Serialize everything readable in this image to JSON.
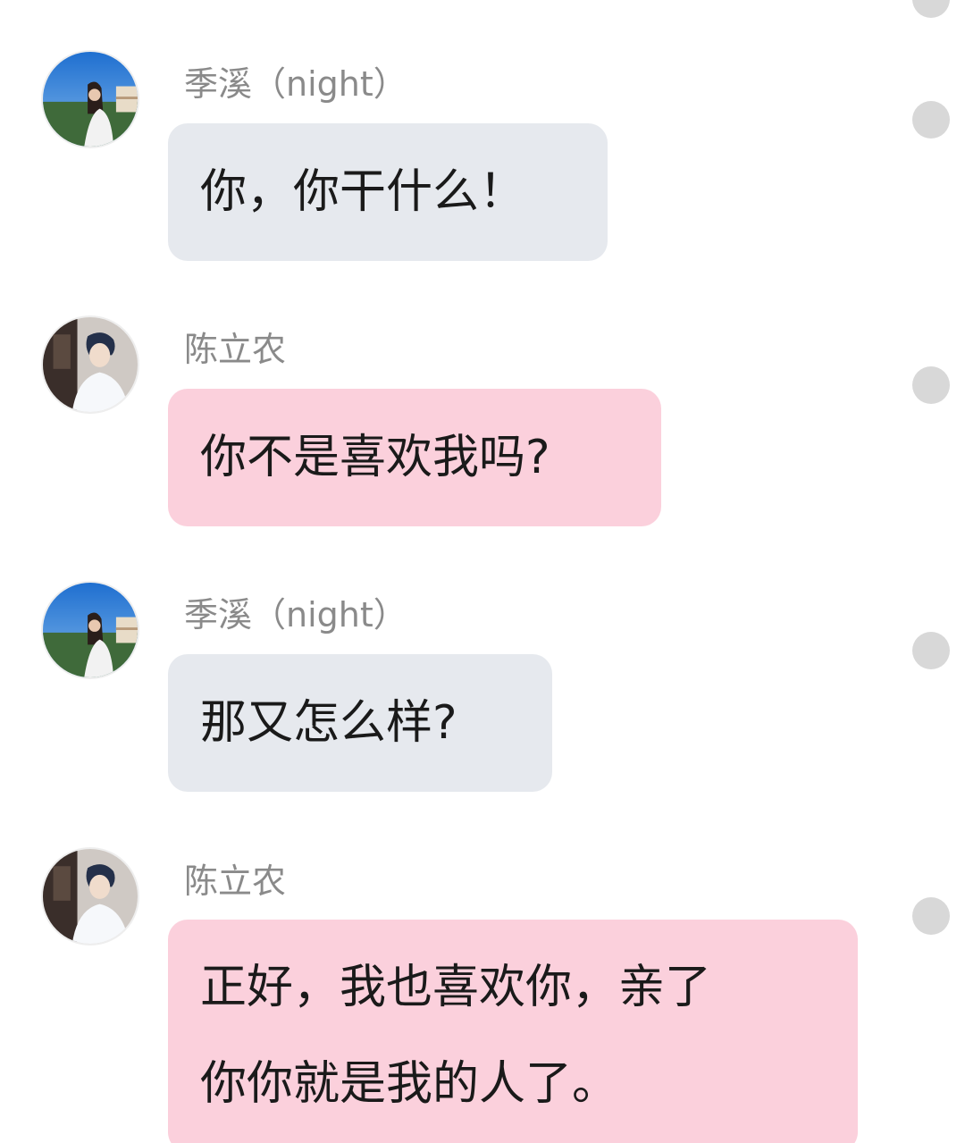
{
  "messages": [
    {
      "sender": "季溪（night）",
      "text": "你，你干什么！",
      "avatar": "girl-avatar",
      "bubble_color": "#e6e9ee"
    },
    {
      "sender": "陈立农",
      "text": "你不是喜欢我吗?",
      "avatar": "boy-avatar",
      "bubble_color": "#fbd0dc"
    },
    {
      "sender": "季溪（night）",
      "text": "那又怎么样?",
      "avatar": "girl-avatar",
      "bubble_color": "#e6e9ee"
    },
    {
      "sender": "陈立农",
      "text_line1": "正好，我也喜欢你，亲了",
      "text_line2": "你你就是我的人了。",
      "avatar": "boy-avatar",
      "bubble_color": "#fbd0dc"
    }
  ]
}
